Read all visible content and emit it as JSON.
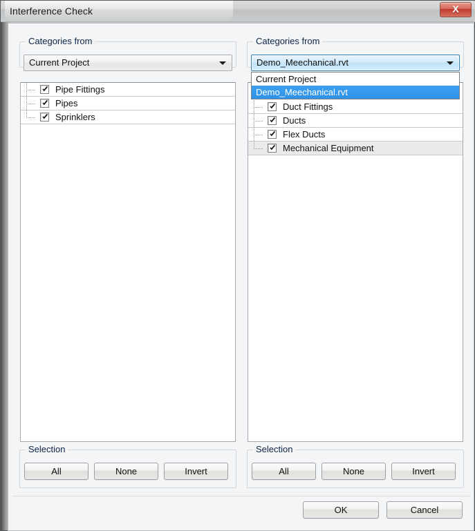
{
  "window": {
    "title": "Interference Check",
    "close_label": "X"
  },
  "left_panel": {
    "group_title": "Categories from",
    "combo": {
      "value": "Current Project",
      "arrow_icon": "chevron-down-icon"
    },
    "items": [
      {
        "label": "Pipe Fittings",
        "checked": true
      },
      {
        "label": "Pipes",
        "checked": true
      },
      {
        "label": "Sprinklers",
        "checked": true
      }
    ],
    "selection": {
      "group_title": "Selection",
      "all": "All",
      "none": "None",
      "invert": "Invert"
    }
  },
  "right_panel": {
    "group_title": "Categories from",
    "combo": {
      "value": "Demo_Meechanical.rvt",
      "arrow_icon": "chevron-down-icon",
      "expanded": true,
      "options": [
        {
          "label": "Current Project",
          "selected": false
        },
        {
          "label": "Demo_Meechanical.rvt",
          "selected": true
        }
      ]
    },
    "items": [
      {
        "label": "Duct Fittings",
        "checked": true
      },
      {
        "label": "Ducts",
        "checked": true
      },
      {
        "label": "Flex Ducts",
        "checked": true
      },
      {
        "label": "Mechanical Equipment",
        "checked": true
      }
    ],
    "selection": {
      "group_title": "Selection",
      "all": "All",
      "none": "None",
      "invert": "Invert"
    }
  },
  "footer": {
    "ok": "OK",
    "cancel": "Cancel"
  },
  "colors": {
    "accent_blue": "#2e92e8",
    "close_red": "#c0392b",
    "dialog_bg": "#f4f5f6"
  }
}
